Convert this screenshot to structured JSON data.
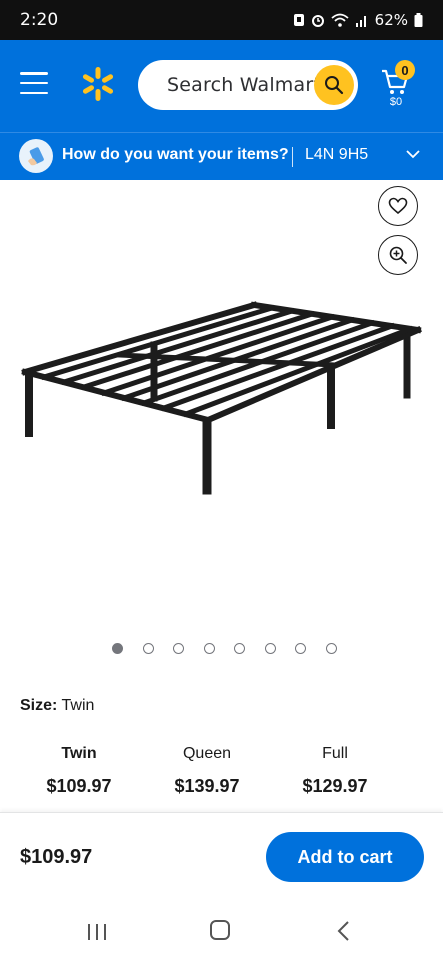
{
  "status_bar": {
    "time": "2:20",
    "battery": "62%"
  },
  "header": {
    "search_placeholder": "Search Walmart",
    "cart_count": "0",
    "cart_total": "$0",
    "brand_color": "#0071dc",
    "accent_color": "#ffc220"
  },
  "delivery": {
    "prompt": "How do you want your items?",
    "postal_code": "L4N 9H5"
  },
  "product": {
    "image_icons": [
      "heart-icon",
      "zoom-in-icon"
    ],
    "carousel": {
      "total": 8,
      "active": 1
    }
  },
  "size_selector": {
    "label": "Size:",
    "selected": "Twin",
    "options": [
      {
        "name": "Twin",
        "price": "$109.97"
      },
      {
        "name": "Queen",
        "price": "$139.97"
      },
      {
        "name": "Full",
        "price": "$129.97"
      }
    ]
  },
  "bottom_bar": {
    "price": "$109.97",
    "add_to_cart_label": "Add to cart"
  }
}
